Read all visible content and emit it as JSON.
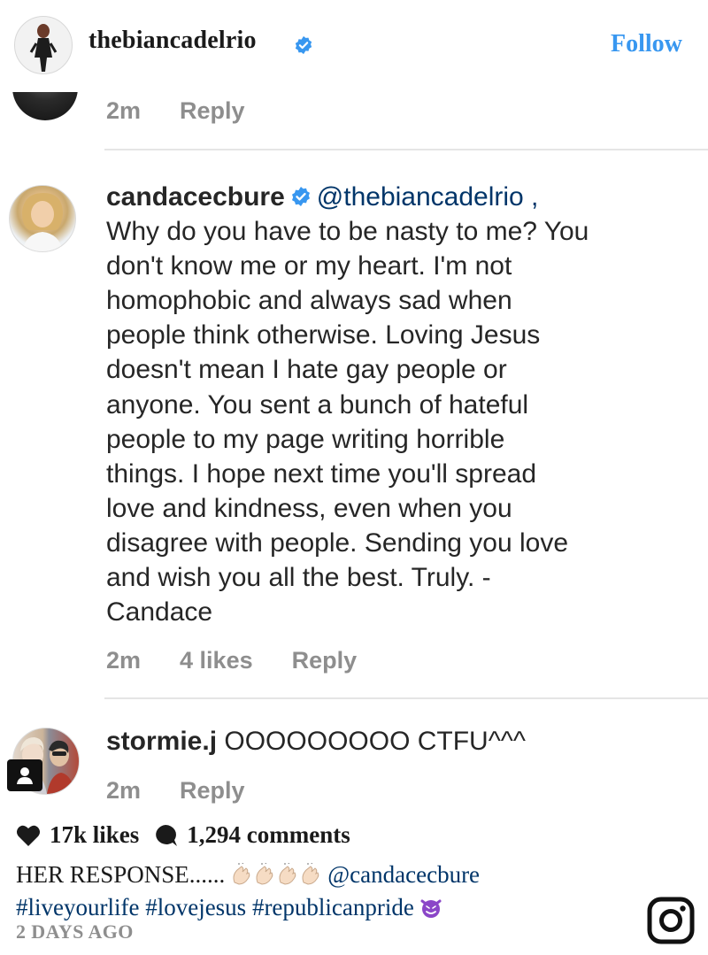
{
  "header": {
    "username": "thebiancadelrio",
    "follow_label": "Follow"
  },
  "previous_comment": {
    "time": "2m",
    "reply_label": "Reply"
  },
  "comments": [
    {
      "username": "candacecbure",
      "mention": "@thebiancadelrio ,",
      "text": "Why do you have to be nasty to me? You\ndon't know me or my heart. I'm not\nhomophobic and always sad when\npeople think otherwise. Loving Jesus\ndoesn't mean I hate gay people or\nanyone.  You sent a bunch of hateful\npeople to my page writing horrible\nthings. I hope next time you'll spread\nlove and kindness, even when you\ndisagree with people. Sending you love\nand wish you all the best. Truly. -\nCandace",
      "time": "2m",
      "likes": "4 likes",
      "reply_label": "Reply"
    },
    {
      "username": "stormie.j",
      "text": "OOOOOOOOO CTFU^^^",
      "time": "2m",
      "reply_label": "Reply"
    }
  ],
  "post": {
    "likes": "17k likes",
    "comments_count": "1,294 comments",
    "caption_lead": "HER RESPONSE......",
    "caption_mention": "@candacecbure",
    "hashtags": "#liveyourlife #lovejesus #republicanpride",
    "time_ago": "2 DAYS AGO"
  },
  "icons": {
    "verified": "verified-badge-icon",
    "heart": "heart-icon",
    "comment": "comment-bubble-icon",
    "user": "user-silhouette-icon",
    "clap": "clapping-hands-emoji",
    "devil": "smiling-devil-emoji",
    "instagram": "instagram-logo"
  },
  "colors": {
    "link_blue": "#3897f0",
    "mention_navy": "#003569",
    "muted_gray": "#8e8e8e",
    "devil_purple": "#8b46c8"
  }
}
